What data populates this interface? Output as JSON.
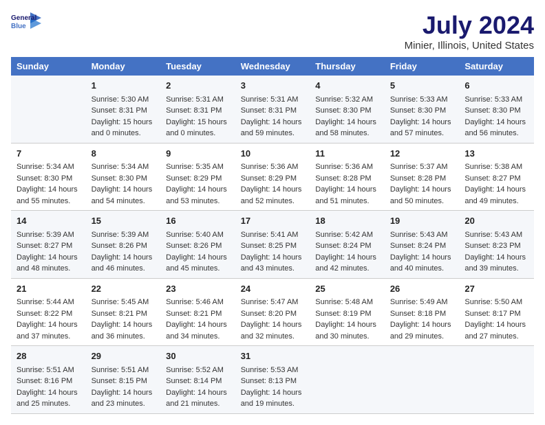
{
  "header": {
    "logo_line1": "General",
    "logo_line2": "Blue",
    "main_title": "July 2024",
    "subtitle": "Minier, Illinois, United States"
  },
  "calendar": {
    "columns": [
      "Sunday",
      "Monday",
      "Tuesday",
      "Wednesday",
      "Thursday",
      "Friday",
      "Saturday"
    ],
    "weeks": [
      [
        {
          "day": "",
          "info": ""
        },
        {
          "day": "1",
          "info": "Sunrise: 5:30 AM\nSunset: 8:31 PM\nDaylight: 15 hours\nand 0 minutes."
        },
        {
          "day": "2",
          "info": "Sunrise: 5:31 AM\nSunset: 8:31 PM\nDaylight: 15 hours\nand 0 minutes."
        },
        {
          "day": "3",
          "info": "Sunrise: 5:31 AM\nSunset: 8:31 PM\nDaylight: 14 hours\nand 59 minutes."
        },
        {
          "day": "4",
          "info": "Sunrise: 5:32 AM\nSunset: 8:30 PM\nDaylight: 14 hours\nand 58 minutes."
        },
        {
          "day": "5",
          "info": "Sunrise: 5:33 AM\nSunset: 8:30 PM\nDaylight: 14 hours\nand 57 minutes."
        },
        {
          "day": "6",
          "info": "Sunrise: 5:33 AM\nSunset: 8:30 PM\nDaylight: 14 hours\nand 56 minutes."
        }
      ],
      [
        {
          "day": "7",
          "info": "Sunrise: 5:34 AM\nSunset: 8:30 PM\nDaylight: 14 hours\nand 55 minutes."
        },
        {
          "day": "8",
          "info": "Sunrise: 5:34 AM\nSunset: 8:30 PM\nDaylight: 14 hours\nand 54 minutes."
        },
        {
          "day": "9",
          "info": "Sunrise: 5:35 AM\nSunset: 8:29 PM\nDaylight: 14 hours\nand 53 minutes."
        },
        {
          "day": "10",
          "info": "Sunrise: 5:36 AM\nSunset: 8:29 PM\nDaylight: 14 hours\nand 52 minutes."
        },
        {
          "day": "11",
          "info": "Sunrise: 5:36 AM\nSunset: 8:28 PM\nDaylight: 14 hours\nand 51 minutes."
        },
        {
          "day": "12",
          "info": "Sunrise: 5:37 AM\nSunset: 8:28 PM\nDaylight: 14 hours\nand 50 minutes."
        },
        {
          "day": "13",
          "info": "Sunrise: 5:38 AM\nSunset: 8:27 PM\nDaylight: 14 hours\nand 49 minutes."
        }
      ],
      [
        {
          "day": "14",
          "info": "Sunrise: 5:39 AM\nSunset: 8:27 PM\nDaylight: 14 hours\nand 48 minutes."
        },
        {
          "day": "15",
          "info": "Sunrise: 5:39 AM\nSunset: 8:26 PM\nDaylight: 14 hours\nand 46 minutes."
        },
        {
          "day": "16",
          "info": "Sunrise: 5:40 AM\nSunset: 8:26 PM\nDaylight: 14 hours\nand 45 minutes."
        },
        {
          "day": "17",
          "info": "Sunrise: 5:41 AM\nSunset: 8:25 PM\nDaylight: 14 hours\nand 43 minutes."
        },
        {
          "day": "18",
          "info": "Sunrise: 5:42 AM\nSunset: 8:24 PM\nDaylight: 14 hours\nand 42 minutes."
        },
        {
          "day": "19",
          "info": "Sunrise: 5:43 AM\nSunset: 8:24 PM\nDaylight: 14 hours\nand 40 minutes."
        },
        {
          "day": "20",
          "info": "Sunrise: 5:43 AM\nSunset: 8:23 PM\nDaylight: 14 hours\nand 39 minutes."
        }
      ],
      [
        {
          "day": "21",
          "info": "Sunrise: 5:44 AM\nSunset: 8:22 PM\nDaylight: 14 hours\nand 37 minutes."
        },
        {
          "day": "22",
          "info": "Sunrise: 5:45 AM\nSunset: 8:21 PM\nDaylight: 14 hours\nand 36 minutes."
        },
        {
          "day": "23",
          "info": "Sunrise: 5:46 AM\nSunset: 8:21 PM\nDaylight: 14 hours\nand 34 minutes."
        },
        {
          "day": "24",
          "info": "Sunrise: 5:47 AM\nSunset: 8:20 PM\nDaylight: 14 hours\nand 32 minutes."
        },
        {
          "day": "25",
          "info": "Sunrise: 5:48 AM\nSunset: 8:19 PM\nDaylight: 14 hours\nand 30 minutes."
        },
        {
          "day": "26",
          "info": "Sunrise: 5:49 AM\nSunset: 8:18 PM\nDaylight: 14 hours\nand 29 minutes."
        },
        {
          "day": "27",
          "info": "Sunrise: 5:50 AM\nSunset: 8:17 PM\nDaylight: 14 hours\nand 27 minutes."
        }
      ],
      [
        {
          "day": "28",
          "info": "Sunrise: 5:51 AM\nSunset: 8:16 PM\nDaylight: 14 hours\nand 25 minutes."
        },
        {
          "day": "29",
          "info": "Sunrise: 5:51 AM\nSunset: 8:15 PM\nDaylight: 14 hours\nand 23 minutes."
        },
        {
          "day": "30",
          "info": "Sunrise: 5:52 AM\nSunset: 8:14 PM\nDaylight: 14 hours\nand 21 minutes."
        },
        {
          "day": "31",
          "info": "Sunrise: 5:53 AM\nSunset: 8:13 PM\nDaylight: 14 hours\nand 19 minutes."
        },
        {
          "day": "",
          "info": ""
        },
        {
          "day": "",
          "info": ""
        },
        {
          "day": "",
          "info": ""
        }
      ]
    ]
  }
}
